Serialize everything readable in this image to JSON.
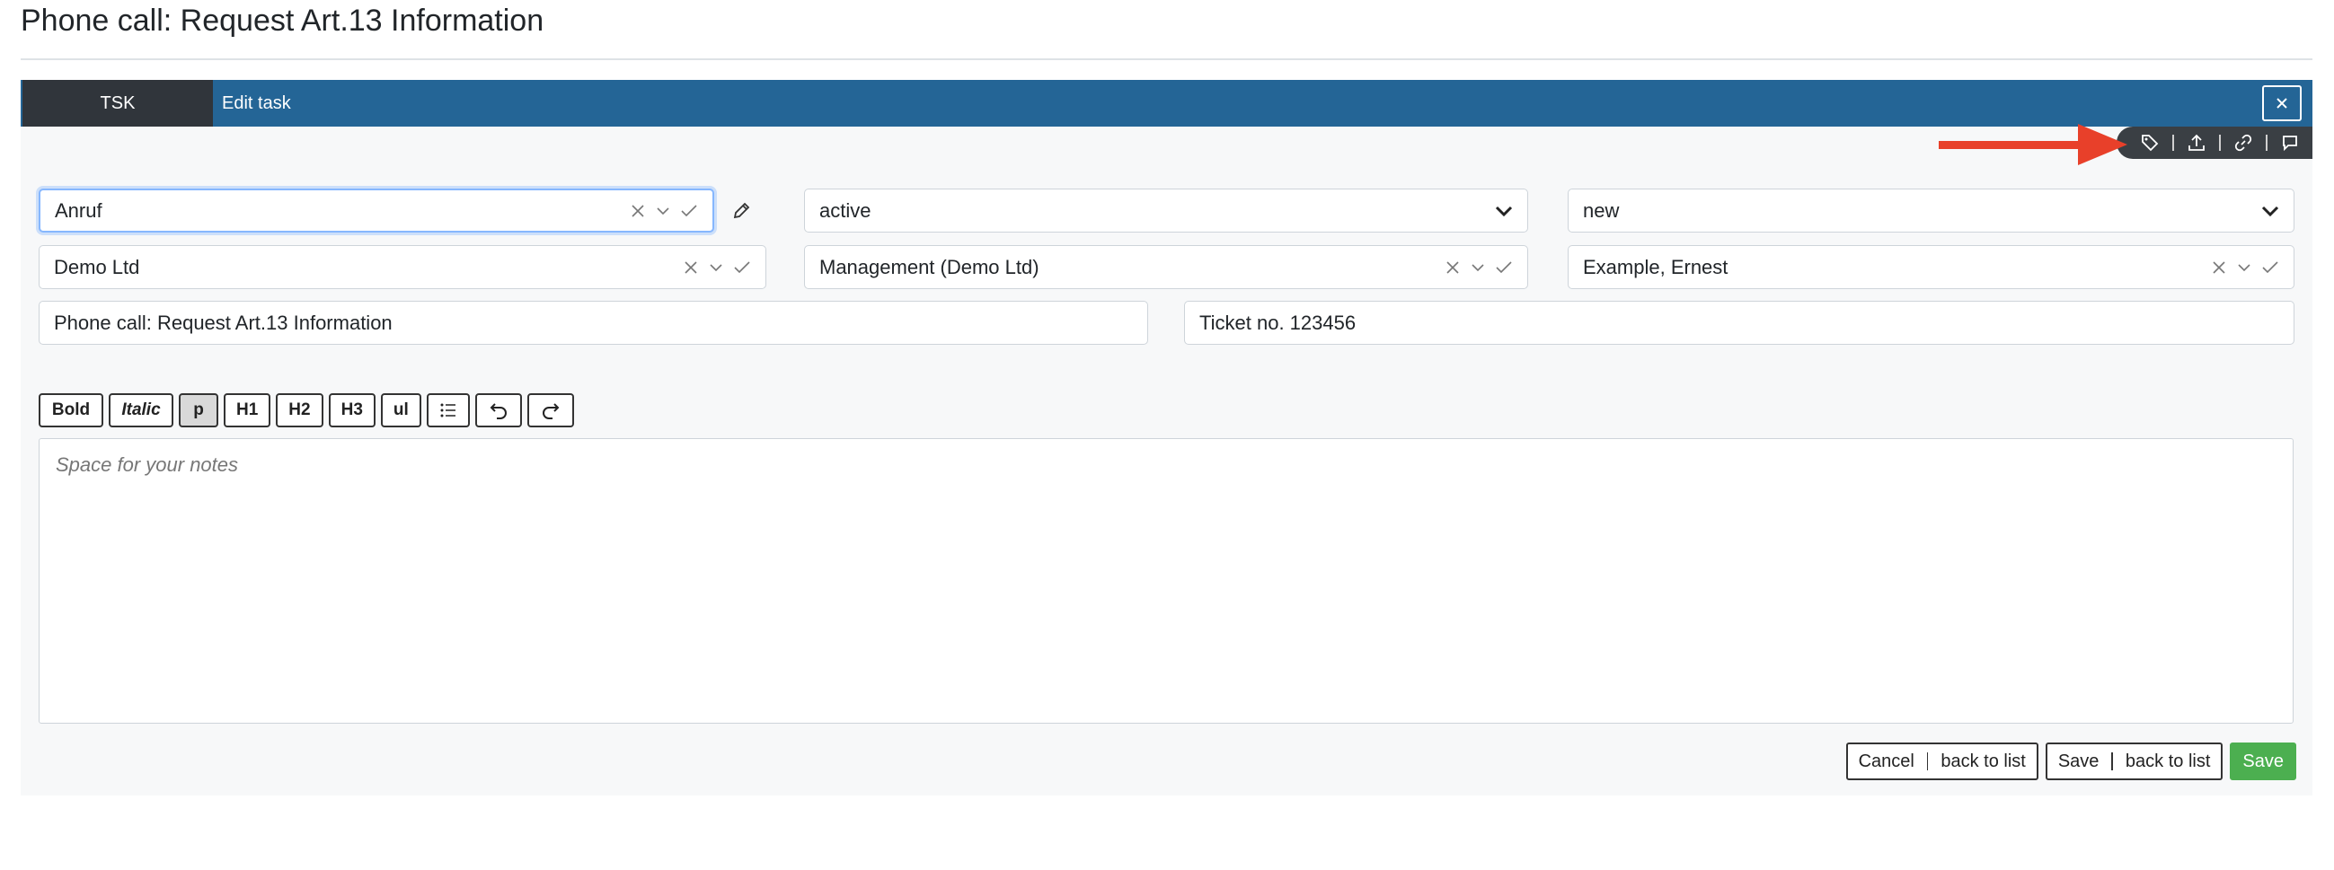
{
  "page": {
    "title": "Phone call: Request Art.13 Information"
  },
  "tabs": {
    "active_tab": "TSK",
    "edit_label": "Edit task"
  },
  "icons": {
    "close": "close-icon",
    "iconbar": [
      "tag-icon",
      "upload-icon",
      "link-icon",
      "comment-icon"
    ]
  },
  "colors": {
    "tabbar": "#246596",
    "active_tab": "#30353b",
    "iconbar": "#3a3f44",
    "arrow": "#e8402a",
    "save": "#4caf50"
  },
  "form": {
    "type": {
      "value": "Anruf"
    },
    "status": {
      "value": "active"
    },
    "state": {
      "value": "new"
    },
    "company": {
      "value": "Demo Ltd"
    },
    "department": {
      "value": "Management (Demo Ltd)"
    },
    "person": {
      "value": "Example, Ernest"
    },
    "subject": {
      "value": "Phone call: Request Art.13 Information"
    },
    "reference": {
      "value": "Ticket no. 123456"
    }
  },
  "editor": {
    "toolbar": [
      "Bold",
      "Italic",
      "p",
      "H1",
      "H2",
      "H3",
      "ul"
    ],
    "placeholder": "Space for your notes"
  },
  "actions": {
    "cancel": "Cancel",
    "back_to_list": "back to list",
    "save": "Save"
  }
}
